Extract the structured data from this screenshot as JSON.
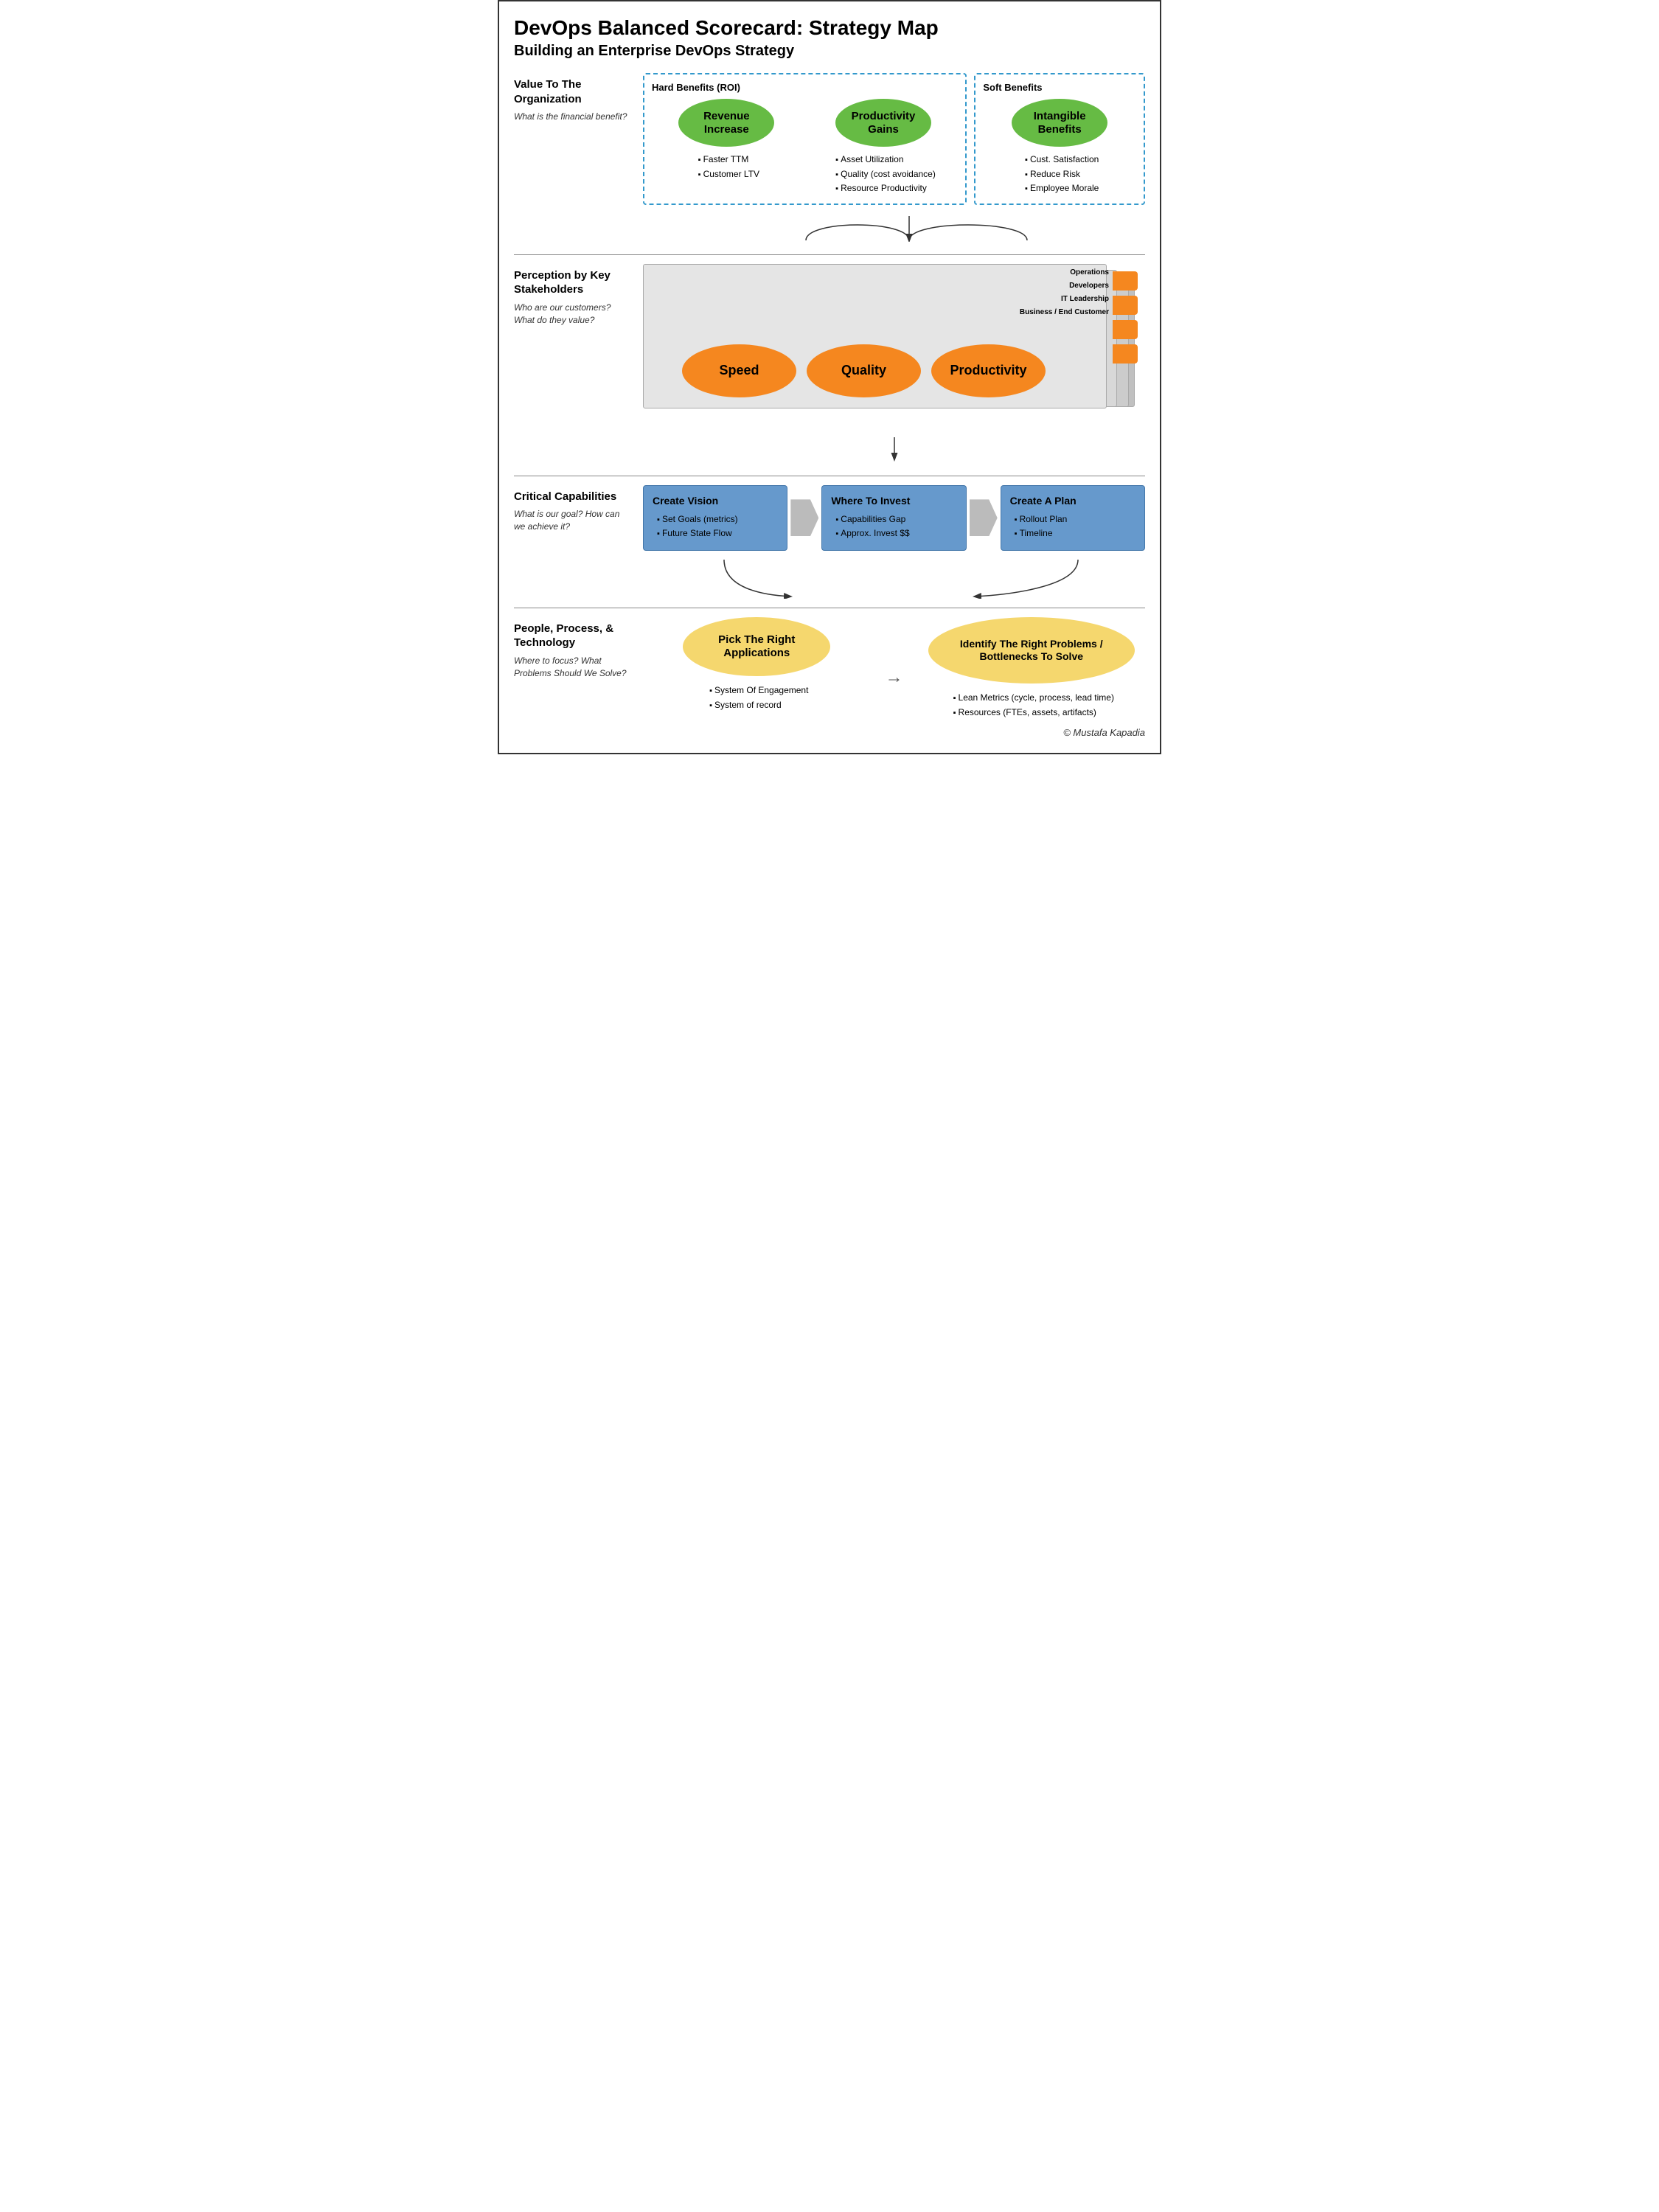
{
  "title": "DevOps Balanced Scorecard: Strategy Map",
  "subtitle": "Building an Enterprise DevOps Strategy",
  "sections": {
    "value": {
      "label": "Value To The Organization",
      "sublabel": "What is the financial benefit?",
      "hard_benefits_title": "Hard Benefits (ROI)",
      "soft_benefits_title": "Soft Benefits",
      "revenue": {
        "title": "Revenue Increase",
        "bullets": [
          "Faster TTM",
          "Customer LTV"
        ]
      },
      "productivity": {
        "title": "Productivity Gains",
        "bullets": [
          "Asset Utilization",
          "Quality (cost avoidance)",
          "Resource Productivity"
        ]
      },
      "intangible": {
        "title": "Intangible Benefits",
        "bullets": [
          "Cust. Satisfaction",
          "Reduce Risk",
          "Employee Morale"
        ]
      }
    },
    "perception": {
      "label": "Perception by Key Stakeholders",
      "sublabel": "Who are our customers? What do they value?",
      "layers": [
        "Operations",
        "Developers",
        "IT Leadership",
        "Business / End Customer"
      ],
      "ovals": [
        "Speed",
        "Quality",
        "Productivity"
      ]
    },
    "capabilities": {
      "label": "Critical Capabilities",
      "sublabel": "What is our goal? How can we achieve it?",
      "boxes": [
        {
          "title": "Create Vision",
          "bullets": [
            "Set Goals (metrics)",
            "Future State Flow"
          ]
        },
        {
          "title": "Where To Invest",
          "bullets": [
            "Capabilities Gap",
            "Approx. Invest $$"
          ]
        },
        {
          "title": "Create A Plan",
          "bullets": [
            "Rollout Plan",
            "Timeline"
          ]
        }
      ]
    },
    "people": {
      "label": "People, Process, & Technology",
      "sublabel": "Where to focus? What Problems Should We Solve?",
      "ovals": [
        {
          "title": "Pick The Right Applications",
          "bullets": [
            "System Of Engagement",
            "System of record"
          ]
        },
        {
          "title": "Identify The Right Problems / Bottlenecks To Solve",
          "bullets": [
            "Lean Metrics (cycle, process, lead time)",
            "Resources (FTEs, assets, artifacts)"
          ]
        }
      ]
    }
  },
  "copyright": "© Mustafa Kapadia"
}
